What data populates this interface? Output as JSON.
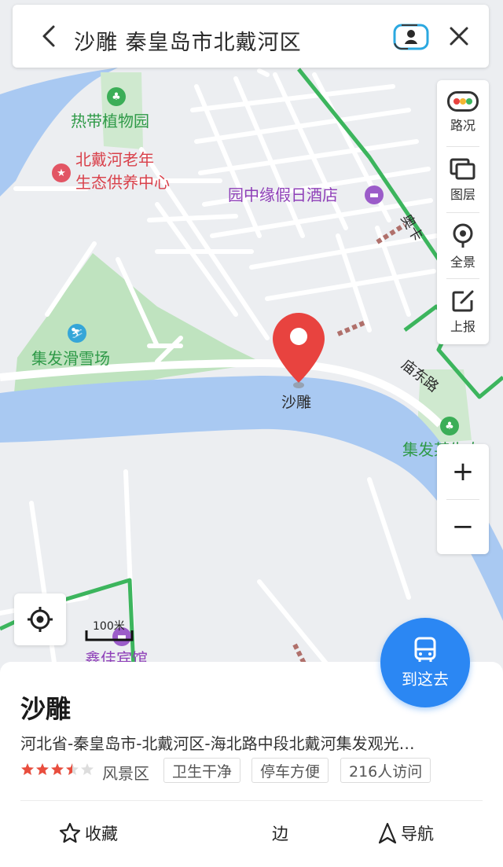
{
  "search": {
    "query": "沙雕 秦皇岛市北戴河区"
  },
  "map": {
    "poi_labels": [
      {
        "id": "tropical",
        "text": "热带植物园"
      },
      {
        "id": "elderly_1",
        "text": "北戴河老年"
      },
      {
        "id": "elderly_2",
        "text": "生态供养中心"
      },
      {
        "id": "hotel",
        "text": "园中缘假日酒店"
      },
      {
        "id": "ski",
        "text": "集发滑雪场"
      },
      {
        "id": "marker",
        "text": "沙雕"
      },
      {
        "id": "jifa_right",
        "text": "集发某生态"
      },
      {
        "id": "guesthouse",
        "text": "鑫佳宾馆"
      }
    ],
    "road_labels": {
      "miaodong": "庙东路",
      "top_road": "奥卡"
    },
    "scale_text": "100米"
  },
  "toolbar": {
    "traffic": "路况",
    "layers": "图层",
    "panorama": "全景",
    "report": "上报"
  },
  "zoom": {
    "in": "+",
    "out": "−"
  },
  "goto_label": "到这去",
  "place": {
    "name": "沙雕",
    "address": "河北省-秦皇岛市-北戴河区-海北路中段北戴河集发观光…",
    "rating": 3.5,
    "rating_max": 5,
    "category": "风景区",
    "tags": [
      "卫生干净",
      "停车方便",
      "216人访问"
    ]
  },
  "actions": {
    "collect": "收藏",
    "nearby": "边",
    "navigate": "导航"
  },
  "colors": {
    "accent": "#2b87f3",
    "river": "#a9c9f2",
    "park": "#bfe3bf",
    "road_green": "#3cb55d",
    "marker": "#e8433f",
    "star": "#e94d3d"
  }
}
